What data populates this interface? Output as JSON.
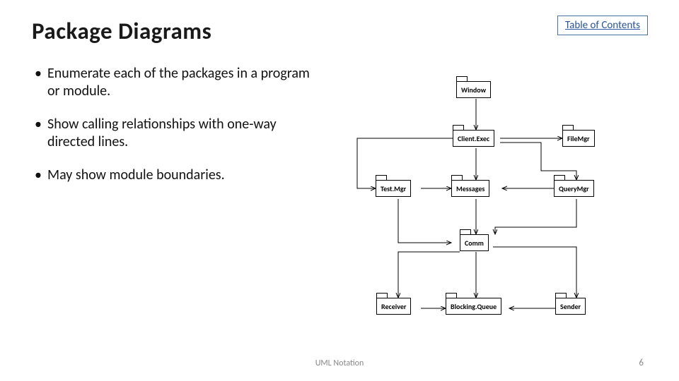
{
  "title": "Package Diagrams",
  "toc_label": "Table of Contents",
  "bullets": [
    "Enumerate each of the packages in a program or module.",
    "Show calling relationships with one-way directed lines.",
    "May show module boundaries."
  ],
  "footer": {
    "center": "UML Notation",
    "page": "6"
  },
  "diagram": {
    "packages": {
      "window": {
        "label": "Window"
      },
      "clientexec": {
        "label": "Client.Exec"
      },
      "filemgr": {
        "label": "FileMgr"
      },
      "testmgr": {
        "label": "Test.Mgr"
      },
      "messages": {
        "label": "Messages"
      },
      "querymgr": {
        "label": "QueryMgr"
      },
      "comm": {
        "label": "Comm"
      },
      "receiver": {
        "label": "Receiver"
      },
      "blockingqueue": {
        "label": "Blocking.Queue"
      },
      "sender": {
        "label": "Sender"
      }
    }
  }
}
